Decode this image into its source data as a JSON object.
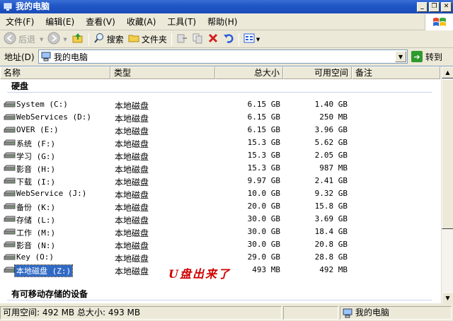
{
  "window": {
    "title": "我的电脑",
    "min_glyph": "_",
    "max_glyph": "❐",
    "close_glyph": "✕"
  },
  "menu": [
    {
      "label": "文件(F)"
    },
    {
      "label": "编辑(E)"
    },
    {
      "label": "查看(V)"
    },
    {
      "label": "收藏(A)"
    },
    {
      "label": "工具(T)"
    },
    {
      "label": "帮助(H)"
    }
  ],
  "toolbar": {
    "back_label": "后退",
    "search_label": "搜索",
    "folders_label": "文件夹"
  },
  "address": {
    "label": "地址(D)",
    "value": "我的电脑",
    "go_label": "转到"
  },
  "columns": {
    "name": "名称",
    "type": "类型",
    "total": "总大小",
    "free": "可用空间",
    "comment": "备注"
  },
  "groups": {
    "hard_disk": "硬盘",
    "removable": "有可移动存储的设备"
  },
  "drives": [
    {
      "name": "System (C:)",
      "type": "本地磁盘",
      "total": "6.15 GB",
      "free": "1.40 GB"
    },
    {
      "name": "WebServices (D:)",
      "type": "本地磁盘",
      "total": "6.15 GB",
      "free": "250 MB"
    },
    {
      "name": "OVER (E:)",
      "type": "本地磁盘",
      "total": "6.15 GB",
      "free": "3.96 GB"
    },
    {
      "name": "系统 (F:)",
      "type": "本地磁盘",
      "total": "15.3 GB",
      "free": "5.62 GB"
    },
    {
      "name": "学习 (G:)",
      "type": "本地磁盘",
      "total": "15.3 GB",
      "free": "2.05 GB"
    },
    {
      "name": "影音 (H:)",
      "type": "本地磁盘",
      "total": "15.3 GB",
      "free": "987 MB"
    },
    {
      "name": "下载 (I:)",
      "type": "本地磁盘",
      "total": "9.97 GB",
      "free": "2.41 GB"
    },
    {
      "name": "WebService (J:)",
      "type": "本地磁盘",
      "total": "10.0 GB",
      "free": "9.32 GB"
    },
    {
      "name": "备份 (K:)",
      "type": "本地磁盘",
      "total": "20.0 GB",
      "free": "15.8 GB"
    },
    {
      "name": "存储 (L:)",
      "type": "本地磁盘",
      "total": "30.0 GB",
      "free": "3.69 GB"
    },
    {
      "name": "工作 (M:)",
      "type": "本地磁盘",
      "total": "30.0 GB",
      "free": "18.4 GB"
    },
    {
      "name": "影音 (N:)",
      "type": "本地磁盘",
      "total": "30.0 GB",
      "free": "20.8 GB"
    },
    {
      "name": "Key (O:)",
      "type": "本地磁盘",
      "total": "29.0 GB",
      "free": "28.8 GB"
    },
    {
      "name": "本地磁盘 (Z:)",
      "type": "本地磁盘",
      "total": "493 MB",
      "free": "492 MB",
      "selected": true
    }
  ],
  "annotation": "U盘出来了",
  "status": {
    "info": "可用空间: 492 MB 总大小: 493 MB",
    "location": "我的电脑"
  },
  "colors": {
    "titlebar": "#2157c7",
    "selection": "#316ac5",
    "annotation": "#d00000"
  }
}
